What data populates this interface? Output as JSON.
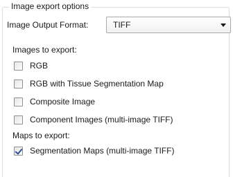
{
  "group": {
    "title": "Image export options"
  },
  "format": {
    "label": "Image Output Format:",
    "selected": "TIFF"
  },
  "images_section": {
    "label": "Images to export:",
    "items": [
      {
        "label": "RGB",
        "checked": false
      },
      {
        "label": "RGB with Tissue Segmentation Map",
        "checked": false
      },
      {
        "label": "Composite Image",
        "checked": false
      },
      {
        "label": "Component Images (multi-image TIFF)",
        "checked": false
      }
    ]
  },
  "maps_section": {
    "label": "Maps to export:",
    "items": [
      {
        "label": "Segmentation Maps (multi-image TIFF)",
        "checked": true
      }
    ]
  },
  "icons": {
    "dropdown": "chevron-down-icon",
    "checkmark": "checkmark-icon"
  },
  "colors": {
    "checkmark": "#2e4d9c",
    "groupbox_border": "#d5dfe5"
  }
}
